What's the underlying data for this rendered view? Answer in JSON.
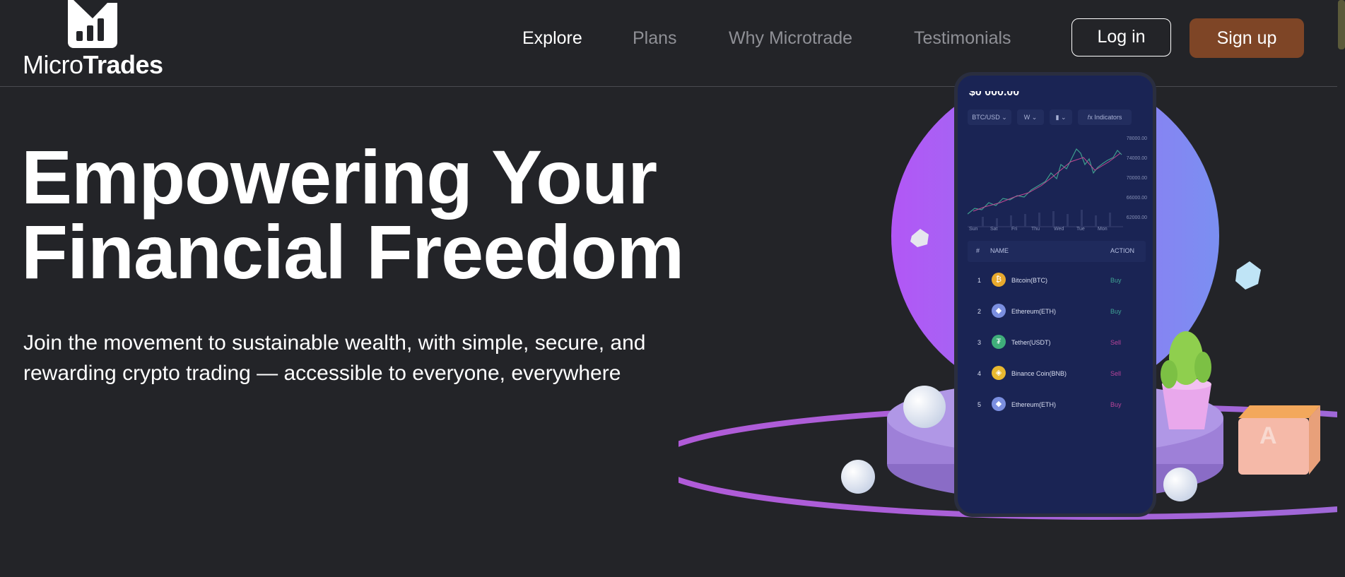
{
  "brand": {
    "logo_light": "Micro",
    "logo_bold": "Trades",
    "icon": "bar-chart-logo-icon"
  },
  "nav": {
    "items": [
      {
        "label": "Explore",
        "active": true
      },
      {
        "label": "Plans",
        "active": false
      },
      {
        "label": "Why Microtrade",
        "active": false
      },
      {
        "label": "Testimonials",
        "active": false
      }
    ],
    "login_label": "Log in",
    "signup_label": "Sign up"
  },
  "hero": {
    "title_line1": "Empowering Your",
    "title_line2": "Financial Freedom",
    "subtitle_line1": "Join the movement to sustainable wealth, with simple, secure, and",
    "subtitle_line2": "rewarding crypto trading — accessible to everyone, everywhere"
  },
  "phone": {
    "price": "$0 000.00",
    "pair": "BTC/USD",
    "interval": "W",
    "indicators_label": "Indicators",
    "y_ticks": [
      "78000.00",
      "74000.00",
      "70000.00",
      "66000.00",
      "62000.00"
    ],
    "x_ticks": [
      "Sun",
      "Sat",
      "Fri",
      "Thu",
      "Wed",
      "Tue",
      "Mon"
    ],
    "table_headers": {
      "index": "#",
      "name": "NAME",
      "action": "ACTION"
    },
    "rows": [
      {
        "num": "1",
        "name": "Bitcoin(BTC)",
        "action": "Buy",
        "color": "#e8a92d"
      },
      {
        "num": "2",
        "name": "Ethereum(ETH)",
        "action": "Buy",
        "color": "#7b8fe0"
      },
      {
        "num": "3",
        "name": "Tether(USDT)",
        "action": "Sell",
        "color": "#3fae7a"
      },
      {
        "num": "4",
        "name": "Binance Coin(BNB)",
        "action": "Sell",
        "color": "#e8b830"
      },
      {
        "num": "5",
        "name": "Ethereum(ETH)",
        "action": "Buy",
        "color": "#7b8fe0"
      }
    ]
  },
  "colors": {
    "background": "#232428",
    "signup_bg": "#7e4526",
    "circle_gradient_start": "#b257f5",
    "circle_gradient_end": "#7b8ff2",
    "podium": "#9e80d8",
    "buy": "#3fa394",
    "sell": "#b9449a"
  }
}
